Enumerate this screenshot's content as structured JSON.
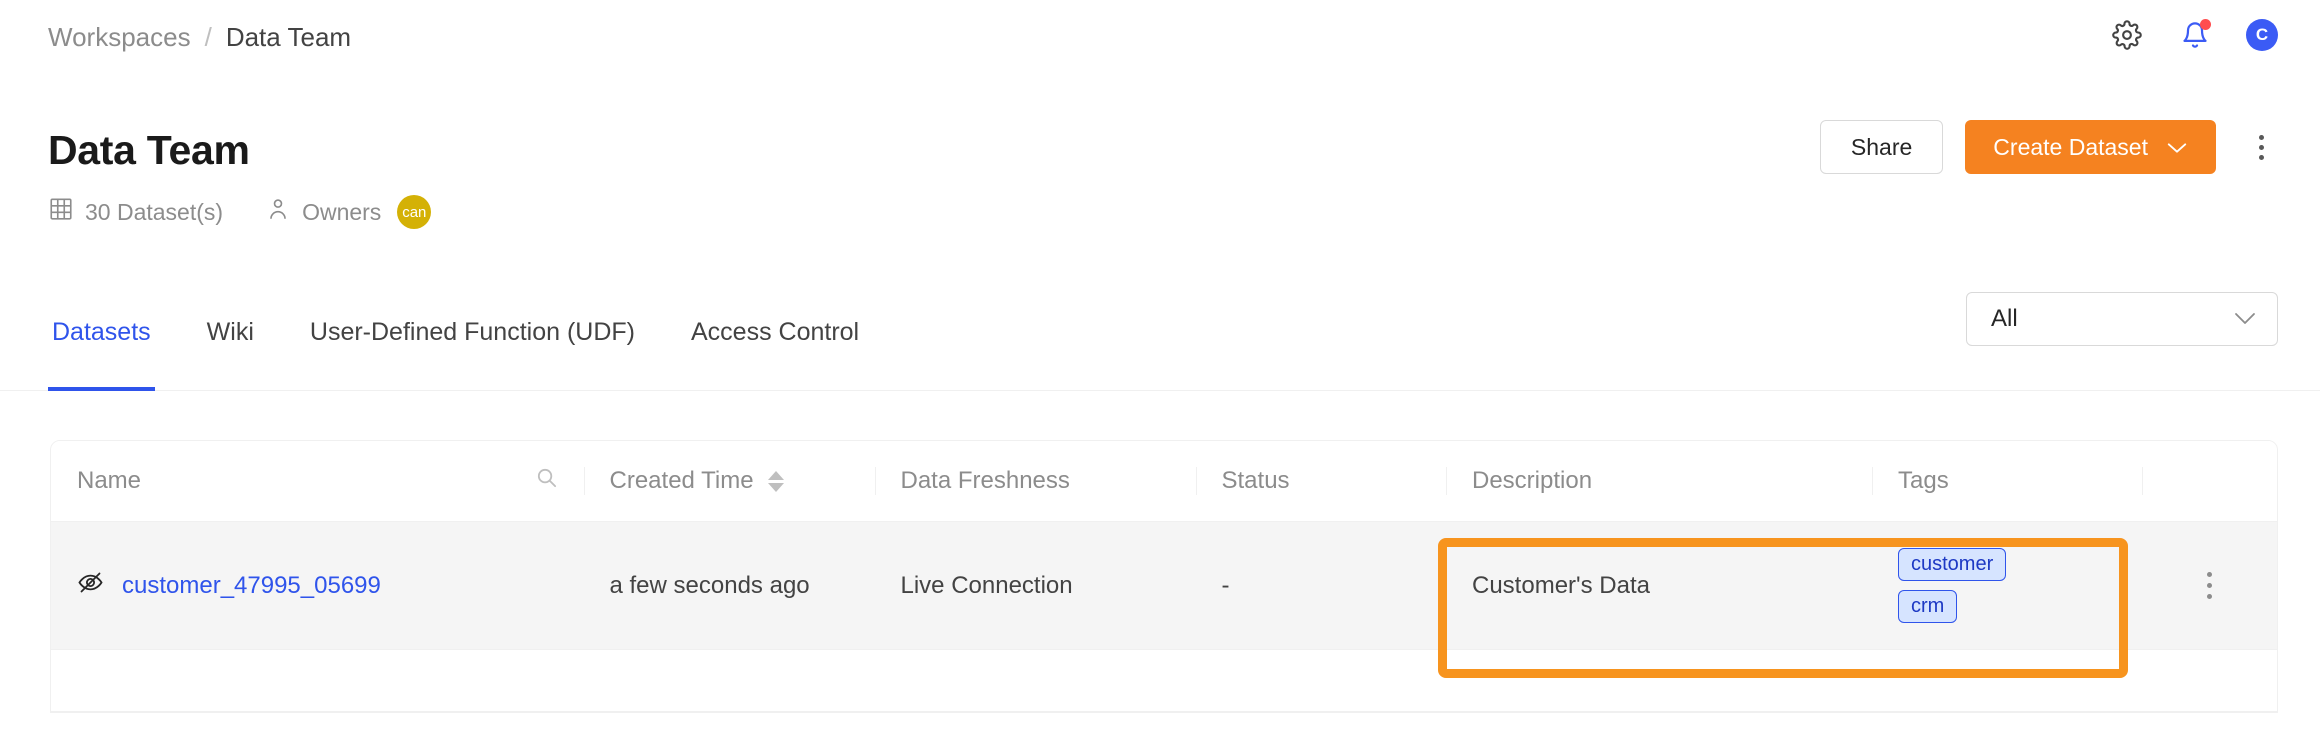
{
  "breadcrumb": {
    "parent": "Workspaces",
    "separator": "/",
    "current": "Data Team"
  },
  "topbar": {
    "settings_icon": "gear-icon",
    "notifications_icon": "bell-icon",
    "has_notification_badge": true,
    "avatar_initial": "C",
    "avatar_color": "#3b5bf5"
  },
  "header": {
    "title": "Data Team",
    "dataset_count_label": "30 Dataset(s)",
    "owners_label": "Owners",
    "owner_avatar_initial": "can",
    "owner_avatar_color": "#d4b106",
    "share_label": "Share",
    "create_label": "Create Dataset",
    "create_color": "#f58220",
    "more_icon": "vertical-dots-icon"
  },
  "tabs": [
    {
      "label": "Datasets",
      "active": true
    },
    {
      "label": "Wiki",
      "active": false
    },
    {
      "label": "User-Defined Function (UDF)",
      "active": false
    },
    {
      "label": "Access Control",
      "active": false
    }
  ],
  "filter": {
    "selected": "All",
    "chevron": "chevron-down-icon"
  },
  "table": {
    "columns": [
      {
        "label": "Name",
        "icon": "search-icon"
      },
      {
        "label": "Created Time",
        "icon": "sort-icon"
      },
      {
        "label": "Data Freshness",
        "icon": ""
      },
      {
        "label": "Status",
        "icon": ""
      },
      {
        "label": "Description",
        "icon": ""
      },
      {
        "label": "Tags",
        "icon": ""
      },
      {
        "label": "",
        "icon": ""
      }
    ],
    "rows": [
      {
        "name": "customer_47995_05699",
        "visibility_icon": "eye-slash-icon",
        "created_time": "a few seconds ago",
        "data_freshness": "Live Connection",
        "status": "-",
        "description": "Customer's Data",
        "tags": [
          "customer",
          "crm"
        ]
      }
    ]
  },
  "annotation": {
    "color": "#f7941e",
    "target": "description-and-tags-cells"
  }
}
